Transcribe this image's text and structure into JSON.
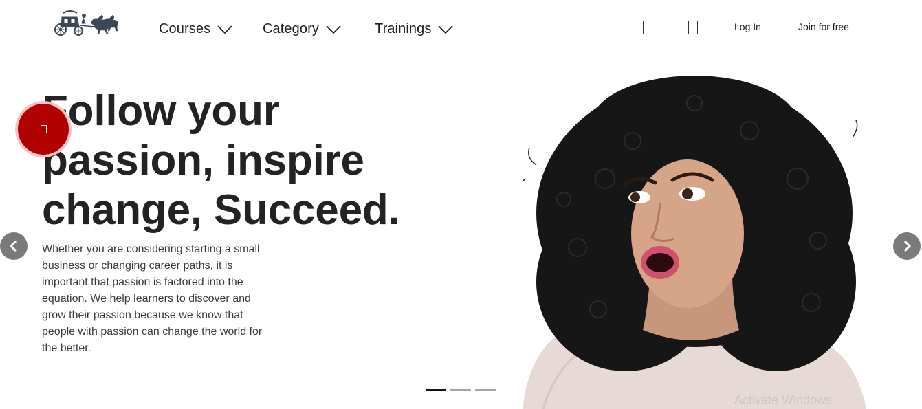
{
  "nav": {
    "items": [
      {
        "label": "Courses"
      },
      {
        "label": "Category"
      },
      {
        "label": "Trainings"
      }
    ],
    "login_label": "Log In",
    "join_label": "Join for free"
  },
  "hero": {
    "headline_lines": [
      "Follow your",
      "passion, inspire",
      "change, Succeed."
    ],
    "body": "Whether you are considering starting a small business or changing career paths, it is important that passion is factored into the equation. We help learners to discover and grow their passion because we know that people with passion can change the world for the better."
  },
  "slider": {
    "dot_count": 3,
    "active_dot": 1
  },
  "watermark": "Activate Windows",
  "colors": {
    "accent_red": "#b10000",
    "accent_red_ring": "#f7c2c2",
    "arrow_bg": "#7a7a7a",
    "text_dark": "#232323"
  }
}
